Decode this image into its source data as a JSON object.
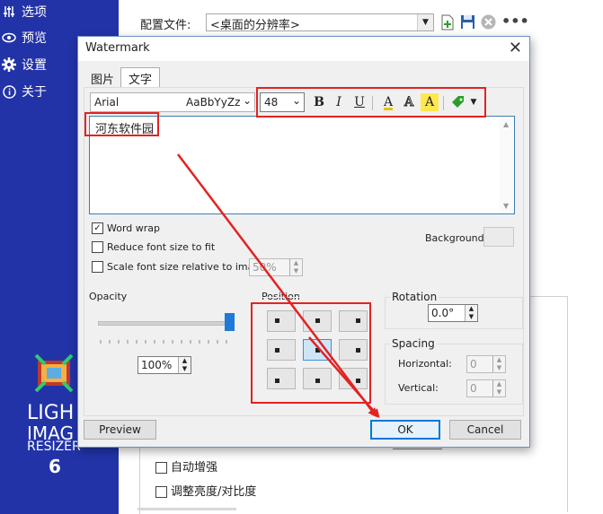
{
  "sidebar": {
    "items": [
      {
        "label": "选项",
        "icon": "sliders-icon"
      },
      {
        "label": "预览",
        "icon": "eye-icon"
      },
      {
        "label": "设置",
        "icon": "gear-icon"
      },
      {
        "label": "关于",
        "icon": "info-icon"
      }
    ],
    "logo_lines": [
      "LIGH",
      "IMAG",
      "RESIZER",
      "6"
    ]
  },
  "app": {
    "profile_label": "配置文件:",
    "profile_value": "<桌面的分辨率>",
    "auto_enhance": "自动增强",
    "adjust_brightness": "调整亮度/对比度"
  },
  "dialog": {
    "title": "Watermark",
    "tabs": [
      "图片",
      "文字"
    ],
    "font_name": "Arial",
    "font_preview": "AaBbYyZz",
    "font_size": "48",
    "text_value": "河东软件园",
    "word_wrap": "Word wrap",
    "reduce_font": "Reduce font size to fit",
    "scale_font": "Scale font size relative to image",
    "scale_value": "50%",
    "background_label": "Background:",
    "opacity_label": "Opacity",
    "opacity_value": "100%",
    "opacity_level": 1.0,
    "position_label": "Position",
    "selected_position": "center",
    "rotation_label": "Rotation",
    "rotation_value": "0.0°",
    "spacing_label": "Spacing",
    "horizontal_label": "Horizontal:",
    "horizontal_value": "0",
    "vertical_label": "Vertical:",
    "vertical_value": "0",
    "preview_btn": "Preview",
    "ok_btn": "OK",
    "cancel_btn": "Cancel"
  },
  "toolbar": {
    "bold": "B",
    "italic": "I",
    "underline": "U",
    "font_color": "A",
    "outline": "A",
    "highlight": "A"
  },
  "colors": {
    "sidebar": "#2233a8",
    "annotation": "#e32222",
    "accent": "#0078d7"
  }
}
